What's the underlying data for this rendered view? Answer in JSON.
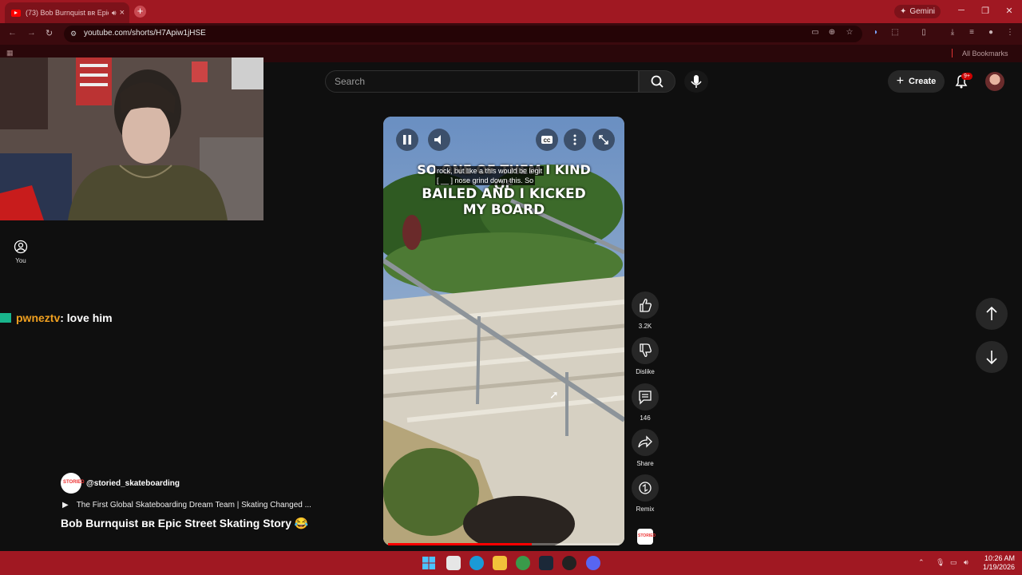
{
  "browser": {
    "tab_title": "(73) Bob Burnquist ʙʀ Epic",
    "new_tab": "+",
    "gemini": "Gemini",
    "url": "youtube.com/shorts/H7Apiw1jHSE",
    "all_bookmarks": "All Bookmarks"
  },
  "youtube": {
    "search_placeholder": "Search",
    "create_label": "Create",
    "notif_badge": "9+",
    "you_label": "You"
  },
  "chat": {
    "username": "pwneztv",
    "message": ": love him"
  },
  "video": {
    "caption_line1": "SO ONE OF THEM I KIND OF",
    "caption_line2": "BAILED AND I KICKED MY BOARD",
    "cc_line1": "rock, but like a this would be legit",
    "cc_line2": "[ __ ] nose grind down this. So",
    "progress": 0.62
  },
  "actions": {
    "likes": "3.2K",
    "dislike": "Dislike",
    "comments": "146",
    "share": "Share",
    "remix": "Remix"
  },
  "channel": {
    "logo_text": "STORIED",
    "handle": "@storied_skateboarding",
    "playlist": "The First Global Skateboarding Dream Team | Skating Changed ...",
    "title": "Bob Burnquist ʙʀ Epic Street Skating Story 😂"
  },
  "taskbar": {
    "time": "10:26 AM",
    "date": "1/19/2026"
  },
  "colors": {
    "chrome_red": "#a01822",
    "yt_bg": "#0f0f0f",
    "progress_red": "#ff0000"
  }
}
